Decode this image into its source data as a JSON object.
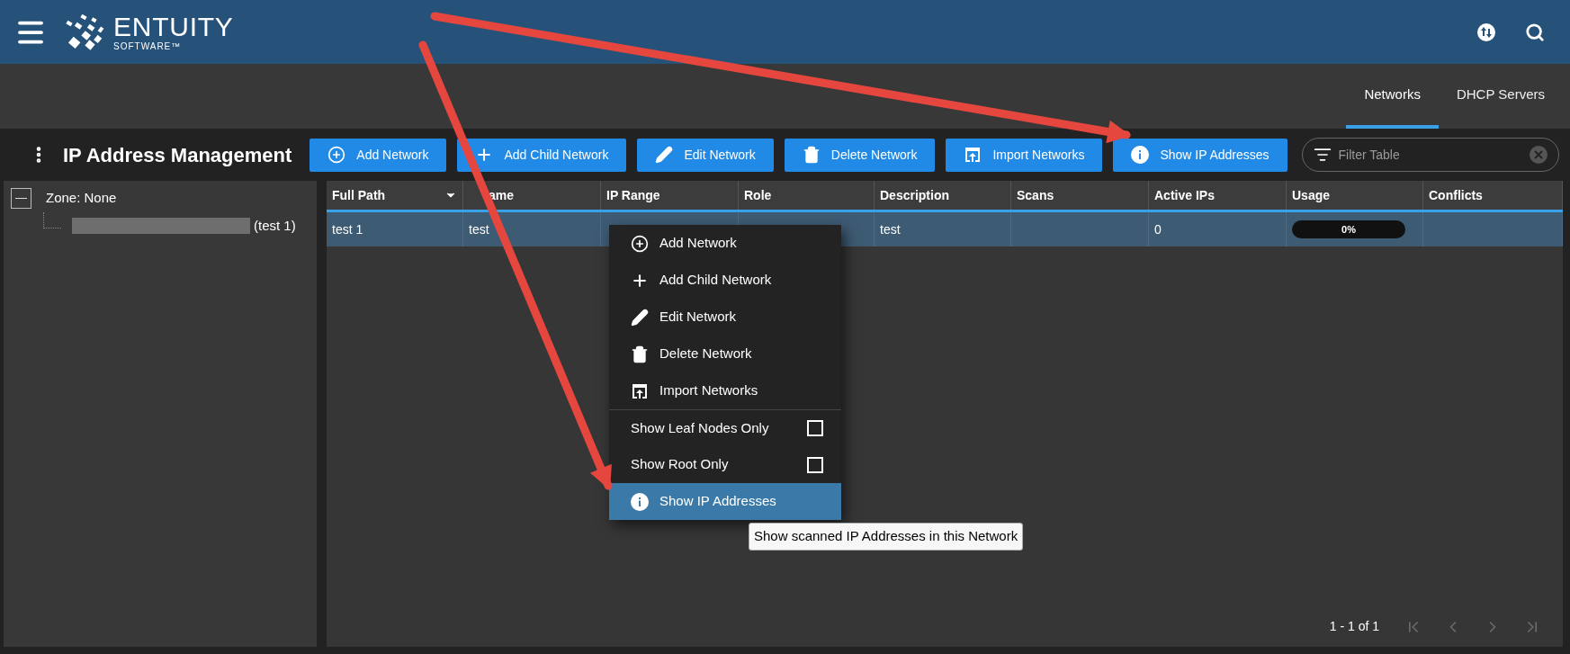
{
  "header": {
    "logo": {
      "name": "ENTUITY",
      "sub": "SOFTWARE™"
    }
  },
  "tabs": [
    {
      "label": "Networks",
      "selected": true
    },
    {
      "label": "DHCP Servers",
      "selected": false
    }
  ],
  "toolbar": {
    "title": "IP Address Management",
    "buttons": [
      {
        "label": "Add Network"
      },
      {
        "label": "Add Child Network"
      },
      {
        "label": "Edit Network"
      },
      {
        "label": "Delete Network"
      },
      {
        "label": "Import Networks"
      },
      {
        "label": "Show IP Addresses"
      }
    ],
    "filter": {
      "placeholder": "Filter Table"
    }
  },
  "tree": [
    {
      "label": "Zone: None",
      "expanded": true,
      "children": [
        {
          "label": "(test 1)",
          "redacted": true
        }
      ]
    }
  ],
  "table": {
    "columns": [
      {
        "label": "Full Path",
        "sorted": true
      },
      {
        "label": "ame",
        "sorted": false
      },
      {
        "label": "IP Range",
        "sorted": false
      },
      {
        "label": "Role",
        "sorted": false
      },
      {
        "label": "Description",
        "sorted": false
      },
      {
        "label": "Scans",
        "sorted": false
      },
      {
        "label": "Active IPs",
        "sorted": false
      },
      {
        "label": "Usage",
        "sorted": false
      },
      {
        "label": "Conflicts",
        "sorted": false
      }
    ],
    "rows": [
      {
        "selected": true,
        "cells": [
          "test 1",
          "test",
          null,
          null,
          "test",
          null,
          "0",
          {
            "kind": "meter",
            "level": 0,
            "reading": "0%"
          },
          null
        ]
      }
    ]
  },
  "context_menu": {
    "items": [
      {
        "kind": "action",
        "label": "Add Network",
        "selected": false
      },
      {
        "kind": "action",
        "label": "Add Child Network",
        "selected": false
      },
      {
        "kind": "action",
        "label": "Edit Network",
        "selected": false
      },
      {
        "kind": "action",
        "label": "Delete Network",
        "selected": false
      },
      {
        "kind": "action",
        "label": "Import Networks",
        "selected": false
      },
      {
        "kind": "toggle",
        "label": "Show Leaf Nodes Only",
        "checked": false
      },
      {
        "kind": "toggle",
        "label": "Show Root Only",
        "checked": false
      },
      {
        "kind": "action",
        "label": "Show IP Addresses",
        "selected": true
      }
    ],
    "tooltip": "Show scanned IP Addresses in this Network"
  },
  "pagination": {
    "range": "1 - 1 of 1",
    "buttons": [
      {
        "disabled": true
      },
      {
        "disabled": true
      },
      {
        "disabled": true
      },
      {
        "disabled": true
      }
    ]
  }
}
